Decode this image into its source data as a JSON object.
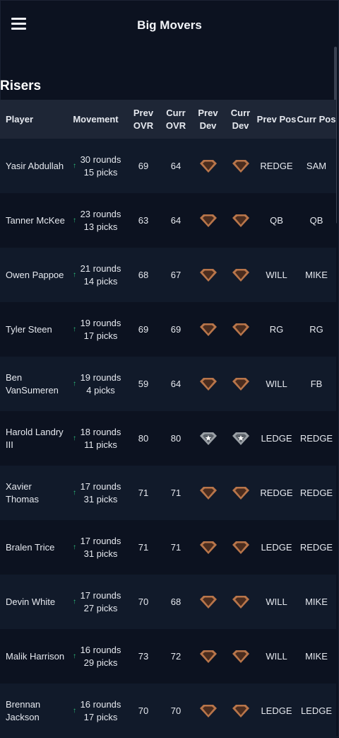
{
  "header": {
    "title": "Big Movers",
    "menu_icon": "hamburger-menu-icon"
  },
  "section": {
    "title": "Risers"
  },
  "table": {
    "columns": {
      "player": "Player",
      "movement": "Movement",
      "prev_ovr": "Prev OVR",
      "curr_ovr": "Curr OVR",
      "prev_dev": "Prev Dev",
      "curr_dev": "Curr Dev",
      "prev_pos": "Prev Pos",
      "curr_pos": "Curr Pos"
    },
    "movement_icon": "arrow-up-icon",
    "rows": [
      {
        "player": "Yasir Abdullah",
        "movement": "30 rounds 15 picks",
        "prev_ovr": "69",
        "curr_ovr": "64",
        "prev_dev": "bronze",
        "curr_dev": "bronze",
        "prev_pos": "REDGE",
        "curr_pos": "SAM"
      },
      {
        "player": "Tanner McKee",
        "movement": "23 rounds 13 picks",
        "prev_ovr": "63",
        "curr_ovr": "64",
        "prev_dev": "bronze",
        "curr_dev": "bronze",
        "prev_pos": "QB",
        "curr_pos": "QB"
      },
      {
        "player": "Owen Pappoe",
        "movement": "21 rounds 14 picks",
        "prev_ovr": "68",
        "curr_ovr": "67",
        "prev_dev": "bronze",
        "curr_dev": "bronze",
        "prev_pos": "WILL",
        "curr_pos": "MIKE"
      },
      {
        "player": "Tyler Steen",
        "movement": "19 rounds 17 picks",
        "prev_ovr": "69",
        "curr_ovr": "69",
        "prev_dev": "bronze",
        "curr_dev": "bronze",
        "prev_pos": "RG",
        "curr_pos": "RG"
      },
      {
        "player": "Ben VanSumeren",
        "movement": "19 rounds 4 picks",
        "prev_ovr": "59",
        "curr_ovr": "64",
        "prev_dev": "bronze",
        "curr_dev": "bronze",
        "prev_pos": "WILL",
        "curr_pos": "FB"
      },
      {
        "player": "Harold Landry III",
        "movement": "18 rounds 11 picks",
        "prev_ovr": "80",
        "curr_ovr": "80",
        "prev_dev": "silver-star",
        "curr_dev": "silver-star",
        "prev_pos": "LEDGE",
        "curr_pos": "REDGE"
      },
      {
        "player": "Xavier Thomas",
        "movement": "17 rounds 31 picks",
        "prev_ovr": "71",
        "curr_ovr": "71",
        "prev_dev": "bronze",
        "curr_dev": "bronze",
        "prev_pos": "REDGE",
        "curr_pos": "REDGE"
      },
      {
        "player": "Bralen Trice",
        "movement": "17 rounds 31 picks",
        "prev_ovr": "71",
        "curr_ovr": "71",
        "prev_dev": "bronze",
        "curr_dev": "bronze",
        "prev_pos": "LEDGE",
        "curr_pos": "REDGE"
      },
      {
        "player": "Devin White",
        "movement": "17 rounds 27 picks",
        "prev_ovr": "70",
        "curr_ovr": "68",
        "prev_dev": "bronze",
        "curr_dev": "bronze",
        "prev_pos": "WILL",
        "curr_pos": "MIKE"
      },
      {
        "player": "Malik Harrison",
        "movement": "16 rounds 29 picks",
        "prev_ovr": "73",
        "curr_ovr": "72",
        "prev_dev": "bronze",
        "curr_dev": "bronze",
        "prev_pos": "WILL",
        "curr_pos": "MIKE"
      },
      {
        "player": "Brennan Jackson",
        "movement": "16 rounds 17 picks",
        "prev_ovr": "70",
        "curr_ovr": "70",
        "prev_dev": "bronze",
        "curr_dev": "bronze",
        "prev_pos": "LEDGE",
        "curr_pos": "LEDGE"
      }
    ]
  },
  "colors": {
    "background": "#0c1220",
    "header_row": "#1e2636",
    "row_alt": "#111a2a",
    "up_arrow": "#2ec27e",
    "bronze_dev": "#b8754a",
    "silver_dev": "#9aa0a6"
  }
}
